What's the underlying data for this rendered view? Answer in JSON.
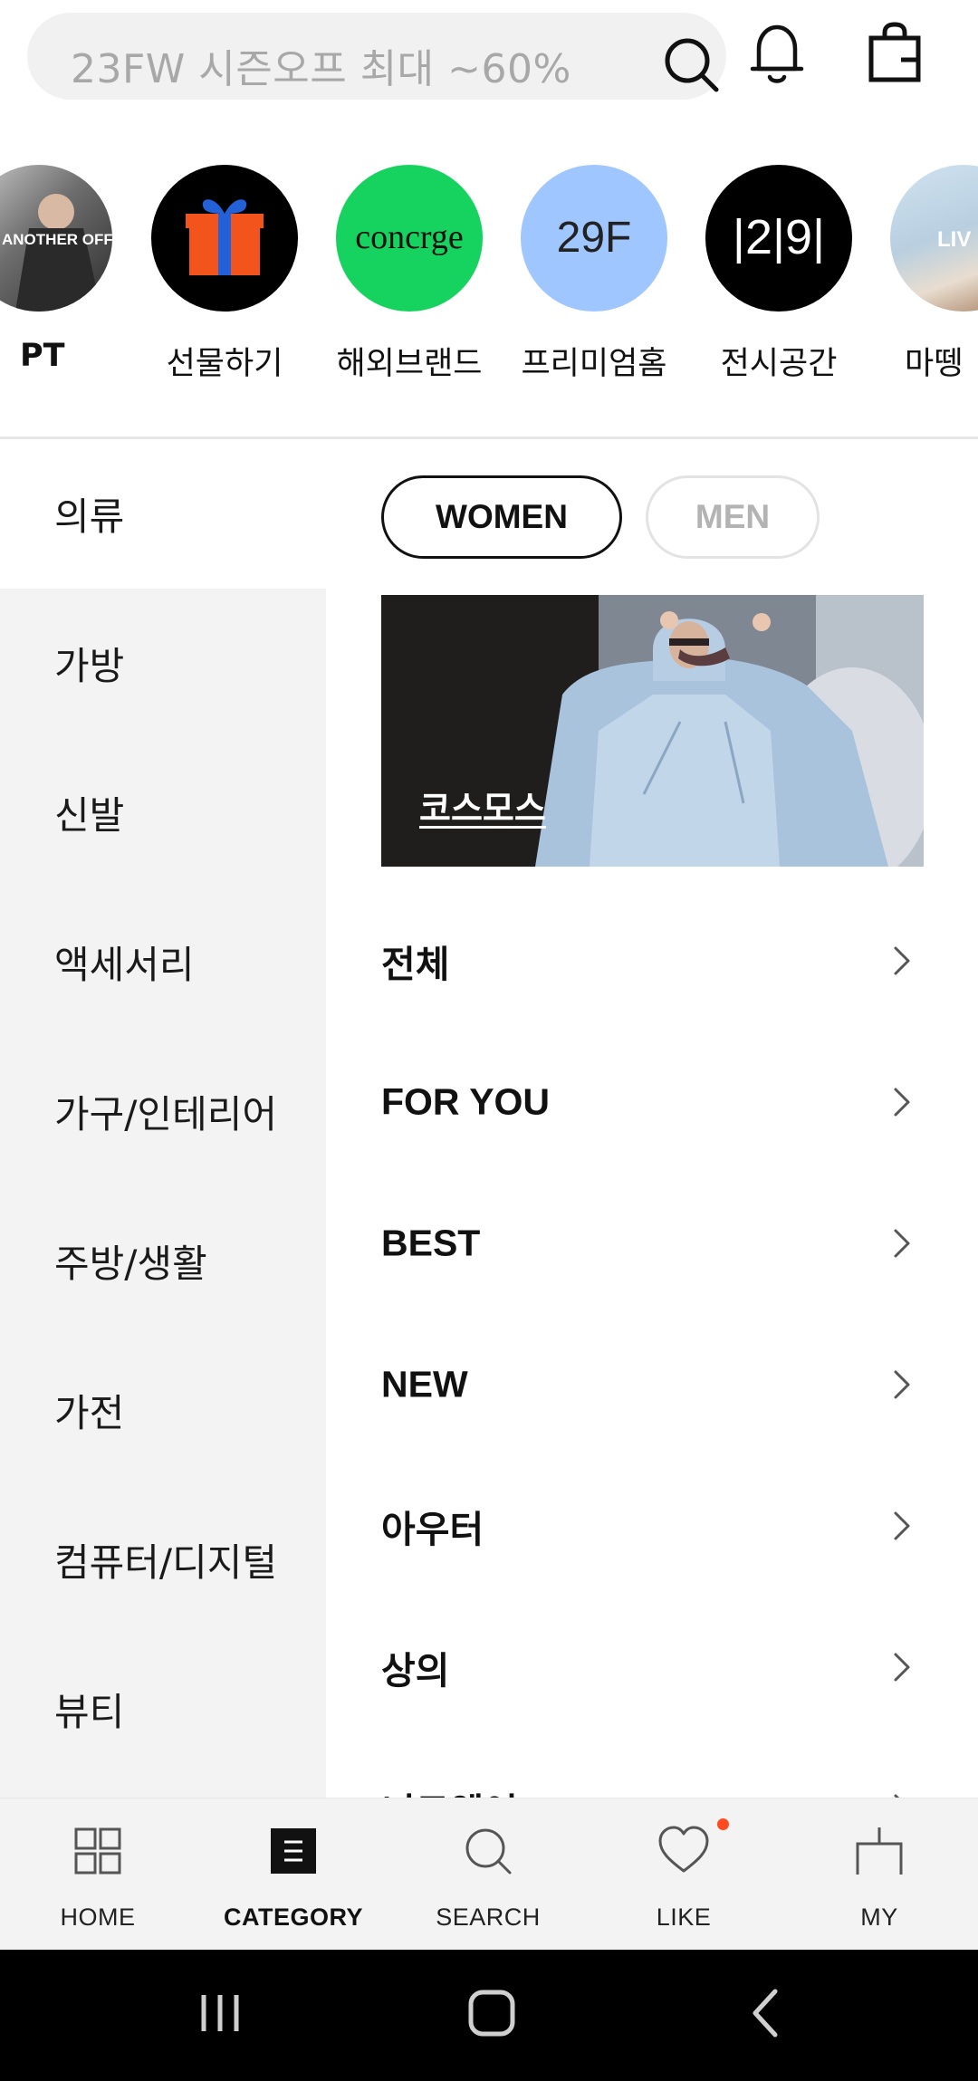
{
  "header": {
    "search_placeholder": "23FW 시즌오프 최대 ~60%"
  },
  "stories": [
    {
      "label": "PT",
      "thumb_text": "ANOTHER OFFICE."
    },
    {
      "label": "선물하기",
      "thumb_text": ""
    },
    {
      "label": "해외브랜드",
      "thumb_text": "concrge"
    },
    {
      "label": "프리미엄홈",
      "thumb_text": "29F"
    },
    {
      "label": "전시공간",
      "thumb_text": "|2|9|"
    },
    {
      "label": "마뗑",
      "thumb_text": "LIV"
    }
  ],
  "left_menu": {
    "items": [
      "의류",
      "가방",
      "신발",
      "액세서리",
      "가구/인테리어",
      "주방/생활",
      "가전",
      "컴퓨터/디지털",
      "뷰티"
    ],
    "active": "의류"
  },
  "gender_tabs": {
    "women": "WOMEN",
    "men": "MEN",
    "selected": "WOMEN"
  },
  "banner": {
    "label": "코스모스"
  },
  "sub_categories": [
    "전체",
    "FOR YOU",
    "BEST",
    "NEW",
    "아우터",
    "상의",
    "니트웨어"
  ],
  "bottom_nav": {
    "items": [
      "HOME",
      "CATEGORY",
      "SEARCH",
      "LIKE",
      "MY"
    ],
    "active": "CATEGORY",
    "like_badge_color": "#ff4b1f"
  },
  "colors": {
    "brand_green": "#16d35f",
    "light_blue": "#9fc6ff",
    "gift_red": "#f2541b",
    "gift_blue": "#2361d8"
  }
}
